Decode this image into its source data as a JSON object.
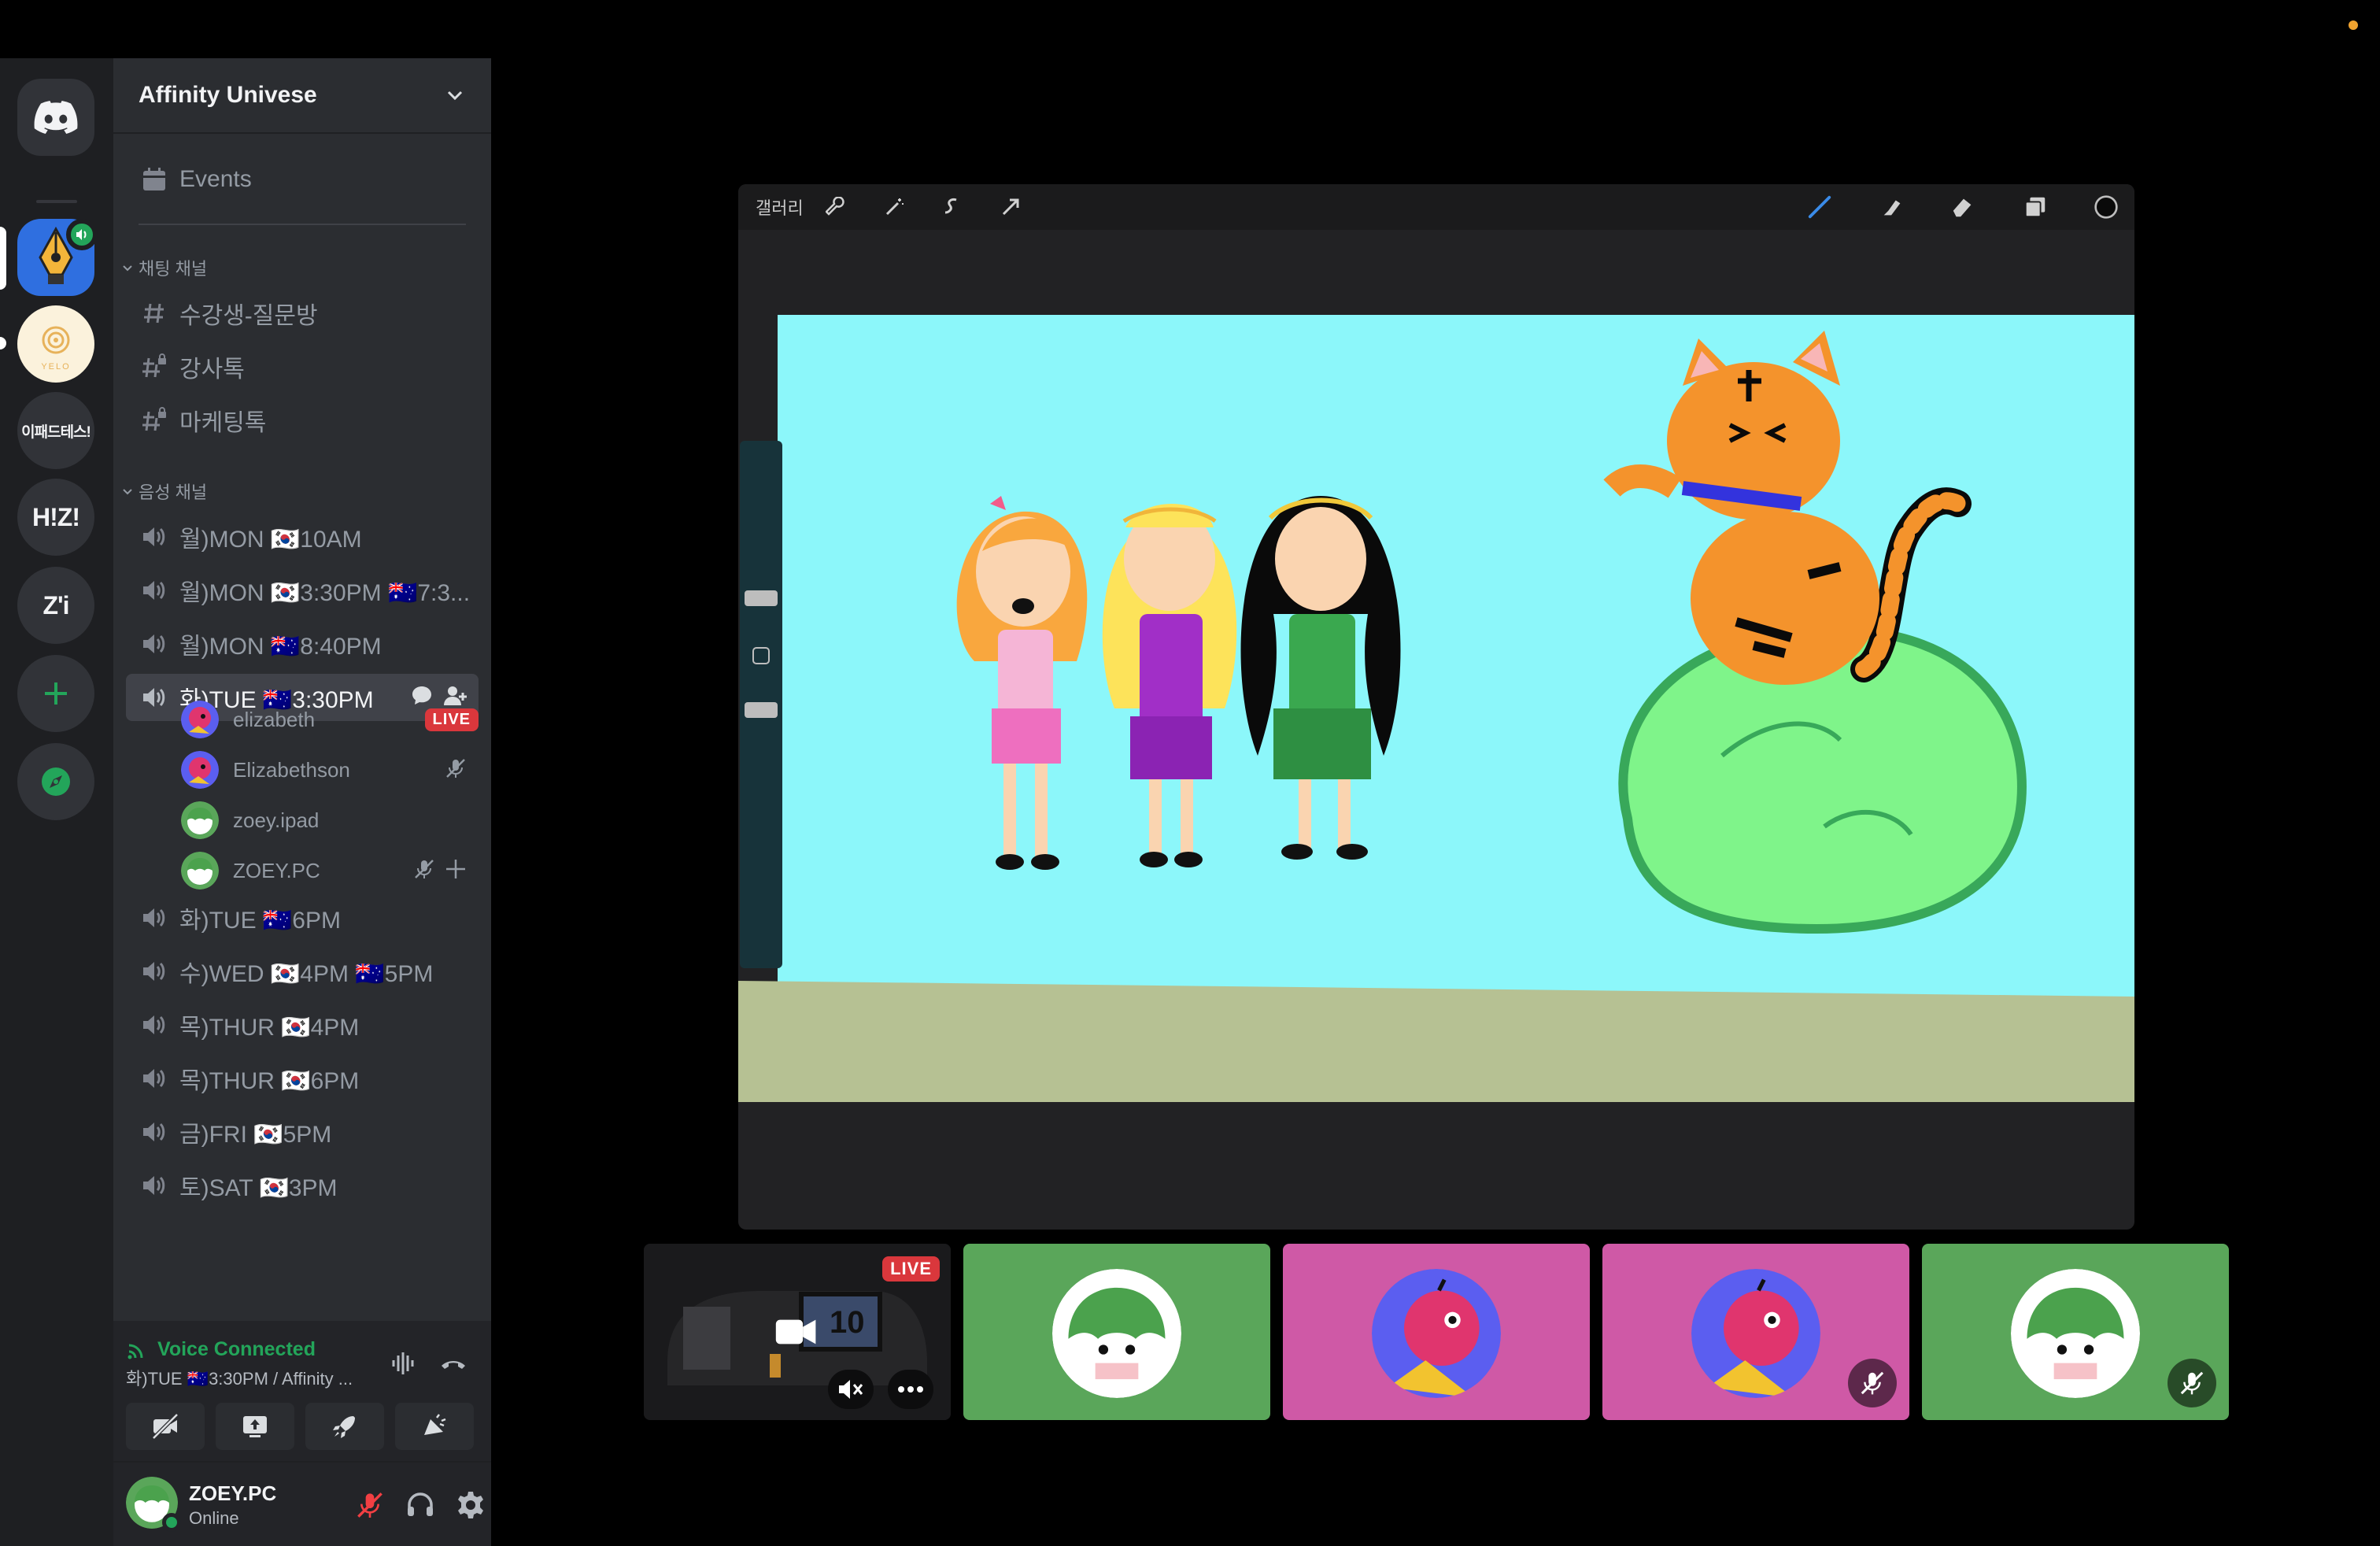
{
  "server": {
    "name": "Affinity Univese",
    "events_label": "Events"
  },
  "rail": {
    "servers": [
      {
        "label": "이패드테스!"
      },
      {
        "label": "H!Z!"
      },
      {
        "label": "Z'i"
      }
    ],
    "yelo_text": "YELO"
  },
  "categories": {
    "text": "채팅 채널",
    "voice": "음성 채널"
  },
  "text_channels": [
    "수강생-질문방",
    "강사톡",
    "마케팅톡"
  ],
  "voice_channels_top": [
    "월)MON 🇰🇷10AM",
    "월)MON 🇰🇷3:30PM 🇦🇺7:3...",
    "월)MON 🇦🇺8:40PM"
  ],
  "active_voice_channel": "화)TUE 🇦🇺3:30PM",
  "members": [
    {
      "name": "elizabeth",
      "badge": "LIVE"
    },
    {
      "name": "Elizabethson"
    },
    {
      "name": "zoey.ipad"
    },
    {
      "name": "ZOEY.PC"
    }
  ],
  "voice_channels_bottom": [
    "화)TUE 🇦🇺6PM",
    "수)WED 🇰🇷4PM 🇦🇺5PM",
    "목)THUR 🇰🇷4PM",
    "목)THUR 🇰🇷6PM",
    "금)FRI 🇰🇷5PM",
    "토)SAT 🇰🇷3PM"
  ],
  "voice_panel": {
    "status": "Voice Connected",
    "subtitle": "화)TUE 🇦🇺3:30PM / Affinity ..."
  },
  "user": {
    "name": "ZOEY.PC",
    "status": "Online"
  },
  "stream": {
    "gallery_label": "갤러리"
  },
  "tiles": {
    "live_badge": "LIVE",
    "screen_number": "10"
  },
  "colors": {
    "sky": "#8cf7fa",
    "ground": "#b6c193",
    "green_tile": "#5aa65a",
    "pink_tile": "#cf59a6",
    "voice_green": "#23a55a",
    "live_red": "#da373c"
  }
}
